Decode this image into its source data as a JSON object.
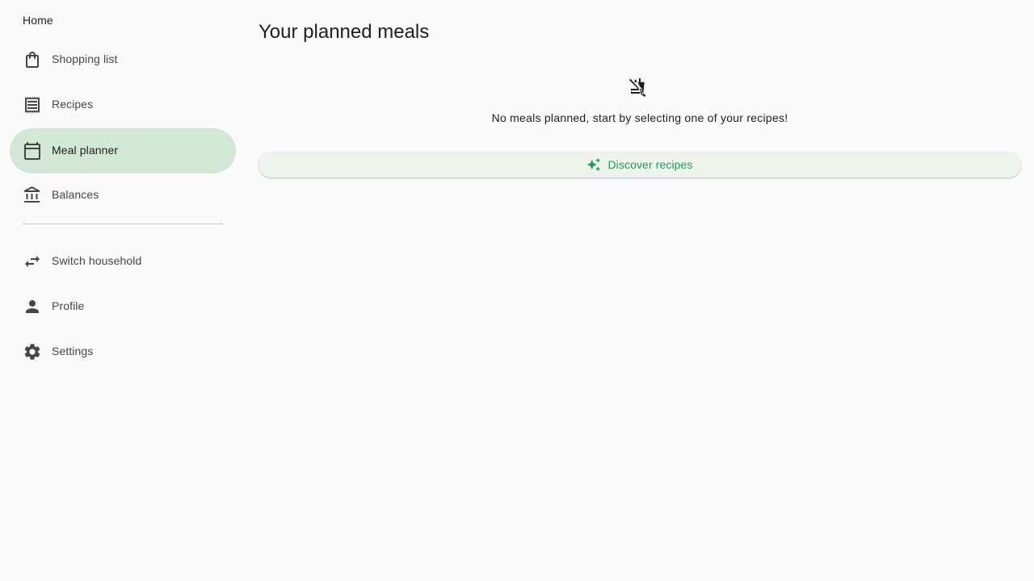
{
  "sidebar": {
    "home_label": "Home",
    "items": [
      {
        "label": "Shopping list",
        "icon": "shopping-bag-icon"
      },
      {
        "label": "Recipes",
        "icon": "receipt-icon"
      },
      {
        "label": "Meal planner",
        "icon": "calendar-icon",
        "active": true
      },
      {
        "label": "Balances",
        "icon": "bank-icon"
      },
      {
        "label": "Switch household",
        "icon": "swap-icon"
      },
      {
        "label": "Profile",
        "icon": "person-icon"
      },
      {
        "label": "Settings",
        "icon": "gear-icon"
      }
    ],
    "active_color": "#d2e7d6"
  },
  "main": {
    "title": "Your planned meals",
    "empty_icon": "no-food-icon",
    "empty_message": "No meals planned, start by selecting one of your recipes!",
    "discover_button": {
      "label": "Discover recipes",
      "icon": "sparkle-icon",
      "color": "#1e9e5a"
    }
  }
}
